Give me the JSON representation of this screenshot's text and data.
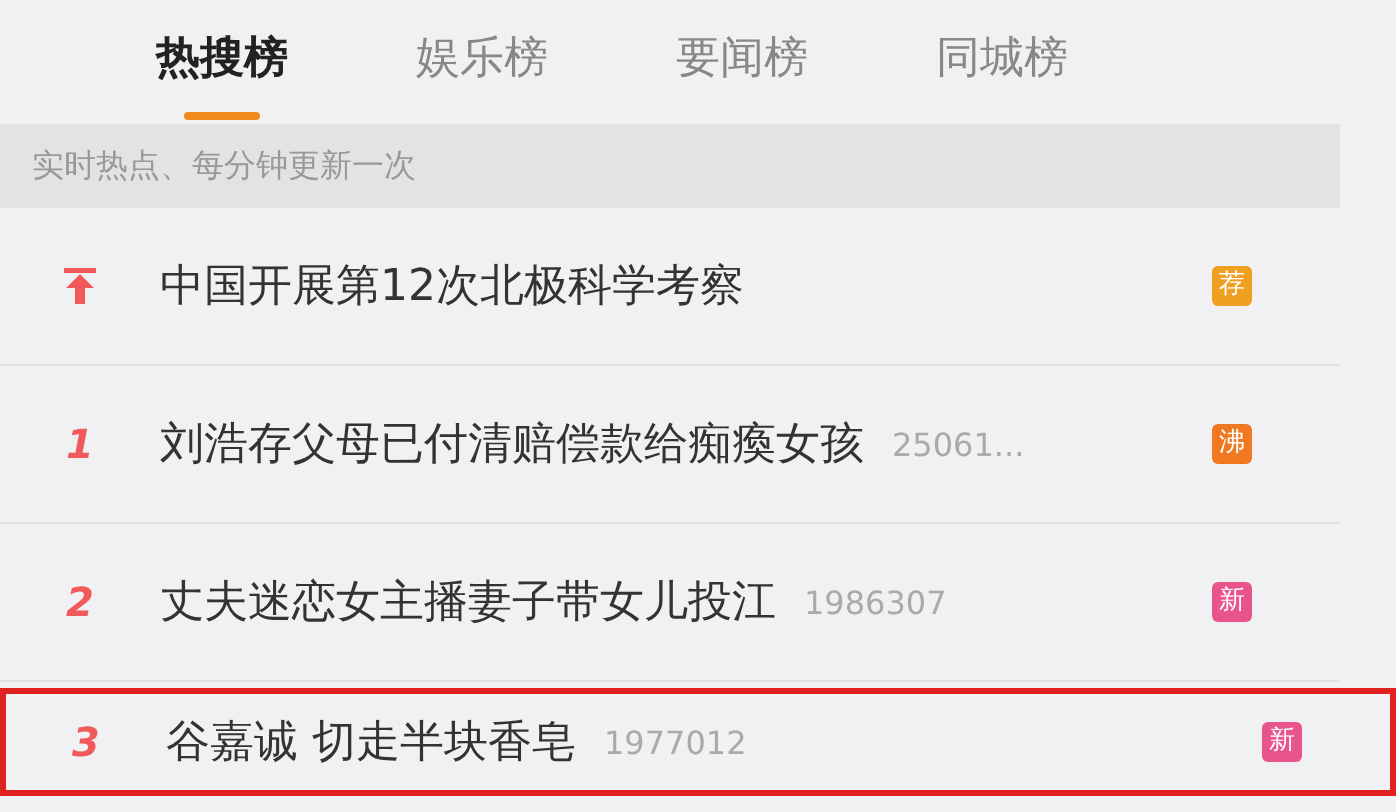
{
  "tabs": [
    {
      "label": "热搜榜",
      "selected": true
    },
    {
      "label": "娱乐榜",
      "selected": false
    },
    {
      "label": "要闻榜",
      "selected": false
    },
    {
      "label": "同城榜",
      "selected": false
    }
  ],
  "notice": "实时热点、每分钟更新一次",
  "items": [
    {
      "kind": "pinned",
      "title": "中国开展第12次北极科学考察",
      "badge": "荐",
      "color": "#f0a020",
      "highlighted": false
    },
    {
      "kind": "ranked",
      "rank": "1",
      "title": "刘浩存父母已付清赔偿款给痴瘓女孩",
      "count": "25061...",
      "badge": "沸",
      "color": "#f07820",
      "highlighted": false
    },
    {
      "kind": "ranked",
      "rank": "2",
      "title": "丈夫迷恋女主播妻子带女儿投江",
      "count": "1986307",
      "badge": "新",
      "color": "#e8558a",
      "highlighted": false
    },
    {
      "kind": "ranked",
      "rank": "3",
      "title": "谷嘉诚 切走半块香皂",
      "count": "1977012",
      "badge": "新",
      "color": "#e8558a",
      "highlighted": true
    }
  ]
}
